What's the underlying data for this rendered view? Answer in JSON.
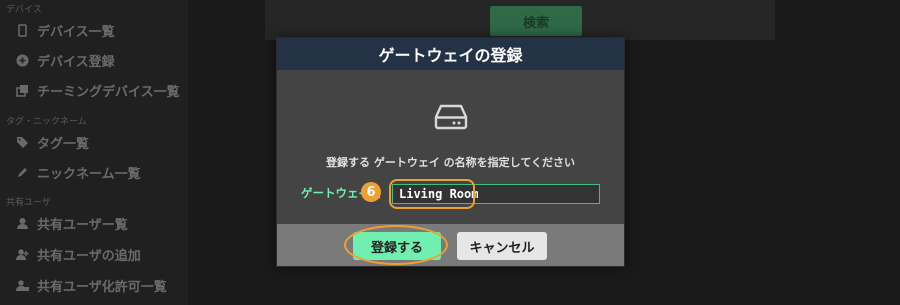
{
  "sidebar": {
    "sections": [
      {
        "label": "デバイス",
        "items": [
          {
            "label": "デバイス一覧",
            "icon": "phone-icon"
          },
          {
            "label": "デバイス登録",
            "icon": "plus-circle-icon"
          },
          {
            "label": "チーミングデバイス一覧",
            "icon": "clone-icon"
          }
        ]
      },
      {
        "label": "タグ・ニックネーム",
        "items": [
          {
            "label": "タグ一覧",
            "icon": "tags-icon"
          },
          {
            "label": "ニックネーム一覧",
            "icon": "pencil-icon"
          }
        ]
      },
      {
        "label": "共有ユーザ",
        "items": [
          {
            "label": "共有ユーザー覧",
            "icon": "user-icon"
          },
          {
            "label": "共有ユーザの追加",
            "icon": "user-plus-icon"
          },
          {
            "label": "共有ユーザ化許可一覧",
            "icon": "user-lock-icon"
          }
        ]
      }
    ]
  },
  "main": {
    "search_label": "検索"
  },
  "modal": {
    "title": "ゲートウェイの登録",
    "icon": "hdd-icon",
    "instruction": "登録する ゲートウェイ の名称を指定してください",
    "field_label": "ゲートウェイ名",
    "field_value": "Living Room",
    "step_badge": "6",
    "register_label": "登録する",
    "cancel_label": "キャンセル"
  },
  "colors": {
    "accent": "#6ff0b0",
    "header": "#233345",
    "highlight": "#f0a030"
  }
}
